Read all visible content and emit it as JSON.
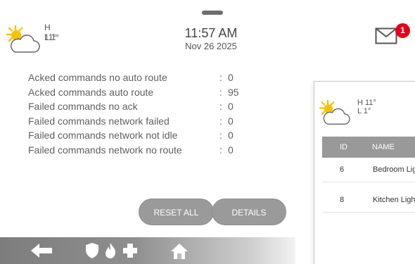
{
  "weather": {
    "high": "H 11°",
    "low": "L 1°",
    "icon": "partly-cloudy-icon"
  },
  "clock": {
    "time": "11:57 AM",
    "date": "Nov 26 2025"
  },
  "messages": {
    "icon": "envelope-icon",
    "badge_count": "1",
    "badge_color": "#e3001b"
  },
  "stats": [
    {
      "label": "Acked commands no auto route",
      "colon": ":",
      "value": "0"
    },
    {
      "label": "Acked commands auto route",
      "colon": ":",
      "value": "95"
    },
    {
      "label": "Failed commands no ack",
      "colon": ":",
      "value": "0"
    },
    {
      "label": "Failed commands network failed",
      "colon": ":",
      "value": "0"
    },
    {
      "label": "Failed commands network not idle",
      "colon": ":",
      "value": "0"
    },
    {
      "label": "Failed commands network no route",
      "colon": ":",
      "value": "0"
    }
  ],
  "actions": {
    "reset_all": "RESET ALL",
    "details": "DETAILS"
  },
  "bottom_bar": {
    "icons": [
      "back-arrow-icon",
      "shield-icon",
      "fire-icon",
      "medical-cross-icon",
      "home-icon"
    ]
  },
  "panel": {
    "weather": {
      "high": "H 11°",
      "low": "L 1°"
    },
    "table": {
      "headers": {
        "id": "ID",
        "name": "NAME"
      },
      "rows": [
        {
          "id": "6",
          "name": "Bedroom Lig"
        },
        {
          "id": "8",
          "name": "Kitchen Ligh"
        }
      ]
    }
  },
  "colors": {
    "button_gray": "#9a9a9a",
    "table_header": "#999999",
    "accent_sun": "#f5c400"
  }
}
